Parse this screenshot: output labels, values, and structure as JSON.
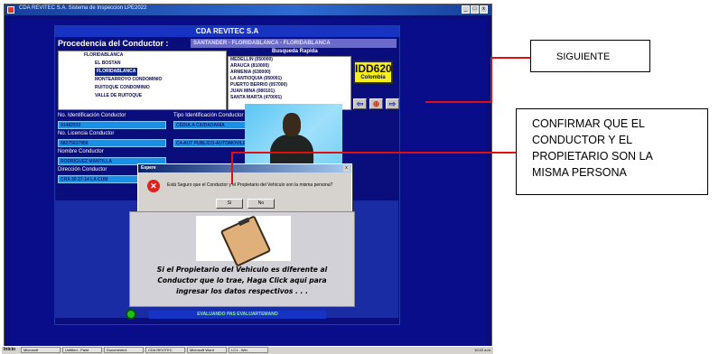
{
  "window": {
    "title": "CDA REVITEC S.A. Sistema de Inspeccion LPE2022"
  },
  "form": {
    "header": "CDA REVITEC S.A",
    "procedencia_label": "Procedencia del Conductor :",
    "procedencia_value": "SANTANDER - FLORIDABLANCA - FLORIDABLANCA",
    "tree_items": [
      "FLORIDABLANCA",
      "EL BOSTAN",
      "FLORIDABLANCA",
      "MONTEARROYO CONDOMINIO",
      "RUITOQUE CONDOMINIO",
      "VALLE DE RUITOQUE"
    ],
    "search_label": "Busqueda Rapida",
    "search_items": [
      "MEDELLIN (050000)",
      "ARAUCA (810000)",
      "ARMENIA (630000)",
      "LA ANTIOQUIA (050001)",
      "PUERTO BERRIO (057000)",
      "JUAN MINA (080101)",
      "SANTA MARTA (470001)"
    ],
    "plate": {
      "number": "IDD620",
      "country": "Colombia"
    },
    "nav": {
      "prev": "⇦",
      "home": "⊕",
      "next": "⇨"
    },
    "fields": {
      "id_label": "No. Identificación Conductor",
      "id_value": "91482532",
      "tipo_label": "Tipo Identificación Conductor",
      "tipo_value": "CÉDULA CIUDADANÍA",
      "licencia_label": "No. Licencia Conductor",
      "licencia_value": "68275637956",
      "servicio_value": "C4-AUT PUBLICO-AUTOMOVILES-CAMPEROS",
      "nombre_label": "Nombre Conductor",
      "nombre_value": "RODRIGUEZ MANTILLA",
      "direccion_label": "Dirección Conductor",
      "direccion_value": "CRA 30 27-14 LA CUM"
    },
    "status_bar": "EVALUANDO PAS EVALUARTEMANO"
  },
  "dialog": {
    "title": "Espere",
    "close": "x",
    "message": "Está Seguro que el Conductor y el Propietario del Vehículo son la misma persona?",
    "yes": "Sí",
    "no": "No"
  },
  "card": {
    "line1": "Si el Propietario del Vehiculo es diferente al",
    "line2": "Conductor que lo trae, Haga Click aqui para",
    "line3": "ingresar los datos respectivos . . ."
  },
  "taskbar": {
    "start": "Inicio",
    "items": [
      "Microsoft",
      "Untitled - Paint",
      "Documento1",
      "CDA REVITEC",
      "Microsoft Word",
      "LC1 - Win"
    ],
    "clock": "10:22 a.m."
  },
  "annotations": {
    "siguiente": "SIGUIENTE",
    "confirm_lines": [
      "CONFIRMAR QUE EL",
      "CONDUCTOR Y EL",
      "PROPIETARIO  SON LA",
      "MISMA PERSONA"
    ]
  },
  "colors": {
    "form_bg": "#0a0d8a",
    "field_bg": "#1a8fe6",
    "plate_bg": "#f7ef19",
    "annotation_line": "#e01010"
  }
}
